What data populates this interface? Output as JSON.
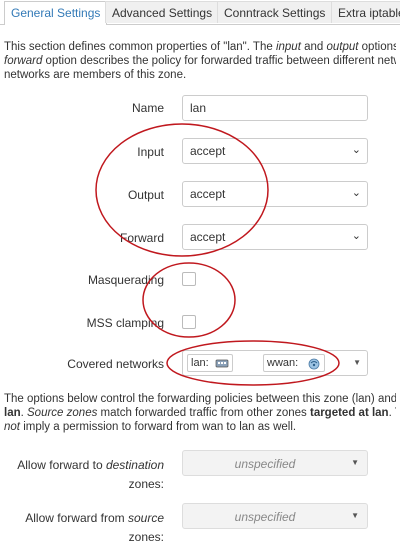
{
  "tabs": [
    {
      "label": "General Settings"
    },
    {
      "label": "Advanced Settings"
    },
    {
      "label": "Conntrack Settings"
    },
    {
      "label": "Extra iptable"
    }
  ],
  "intro": {
    "line1": "This section defines common properties of \"lan\". The ",
    "line1_input": "input",
    "line1_and": " and ",
    "line1_output": "output",
    "line1_rest": " options",
    "line2_forward": "forward",
    "line2_rest": " option describes the policy for forwarded traffic between different netw",
    "line3": "networks are members of this zone."
  },
  "form": {
    "name_label": "Name",
    "name_value": "lan",
    "input_label": "Input",
    "input_value": "accept",
    "output_label": "Output",
    "output_value": "accept",
    "forward_label": "Forward",
    "forward_value": "accept",
    "masquerading_label": "Masquerading",
    "masquerading_checked": false,
    "mss_label": "MSS clamping",
    "mss_checked": false,
    "covered_label": "Covered networks",
    "networks": [
      {
        "name": "lan:",
        "icon": "ethernet-switch-icon"
      },
      {
        "name": "wwan:",
        "icon": "wifi-icon"
      }
    ]
  },
  "policy_intro": {
    "line1": "The options below control the forwarding policies between this zone (lan) and",
    "line2_bold": "lan",
    "line2_rest": ". ",
    "line2_src": "Source zones",
    "line2_mid": " match forwarded traffic from other zones ",
    "line2_target": "targeted at lan",
    "line2_end": ". T",
    "line3_not": "not",
    "line3_rest": " imply a permission to forward from wan to lan as well."
  },
  "policy": {
    "dest_label_prefix": "Allow forward to ",
    "dest_label_em": "destination",
    "dest_label_suffix": "zones:",
    "dest_value": "unspecified",
    "src_label_prefix": "Allow forward from ",
    "src_label_em": "source",
    "src_label_suffix": "zones:",
    "src_value": "unspecified"
  },
  "colors": {
    "accent": "#337ab7",
    "annotation": "#c0181e"
  }
}
